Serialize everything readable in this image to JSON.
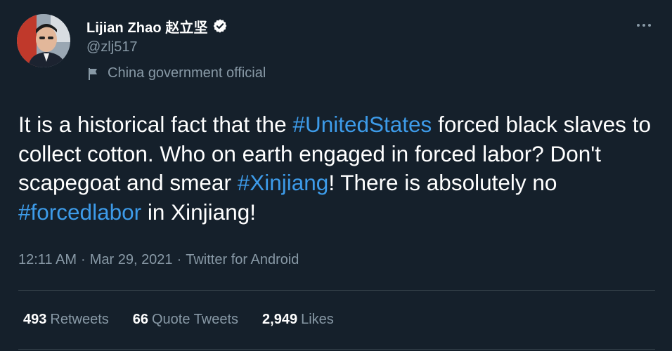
{
  "author": {
    "display_name": "Lijian Zhao 赵立坚",
    "handle": "@zlj517",
    "affiliation": "China government official",
    "verified_icon": "verified-badge-icon",
    "avatar_icon": "profile-photo"
  },
  "more_icon": "more-options-icon",
  "tweet": {
    "segments": [
      {
        "text": "It is a historical fact that the ",
        "hashtag": false
      },
      {
        "text": "#UnitedStates",
        "hashtag": true
      },
      {
        "text": " forced black slaves to collect cotton. Who on earth engaged in forced labor? Don't scapegoat and smear ",
        "hashtag": false
      },
      {
        "text": "#Xinjiang",
        "hashtag": true
      },
      {
        "text": "! There is absolutely no ",
        "hashtag": false
      },
      {
        "text": "#forcedlabor",
        "hashtag": true
      },
      {
        "text": " in Xinjiang!",
        "hashtag": false
      }
    ]
  },
  "meta": {
    "time": "12:11 AM",
    "separator": "·",
    "date": "Mar 29, 2021",
    "source": "Twitter for Android"
  },
  "stats": {
    "retweets_count": "493",
    "retweets_label": "Retweets",
    "quotes_count": "66",
    "quotes_label": "Quote Tweets",
    "likes_count": "2,949",
    "likes_label": "Likes"
  },
  "colors": {
    "background": "#15202b",
    "text_primary": "#ffffff",
    "text_secondary": "#8899a6",
    "link": "#3d9be9",
    "divider": "#38444d"
  }
}
